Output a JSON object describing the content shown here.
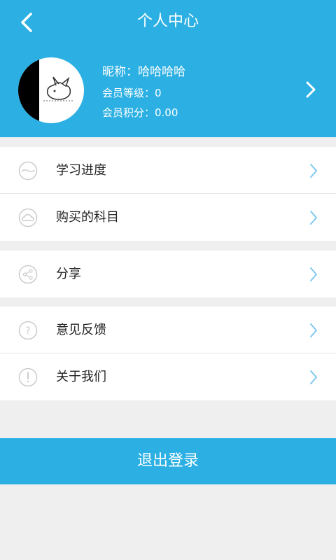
{
  "header": {
    "title": "个人中心",
    "back_icon": "chevron-left-icon"
  },
  "profile": {
    "nickname": "昵称：哈哈哈哈",
    "level": "会员等级：0",
    "points": "会员积分：0.00"
  },
  "menu": {
    "group1": [
      {
        "label": "学习进度",
        "icon": "progress-icon"
      },
      {
        "label": "购买的科目",
        "icon": "cloud-icon"
      }
    ],
    "group2": [
      {
        "label": "分享",
        "icon": "share-icon"
      }
    ],
    "group3": [
      {
        "label": "意见反馈",
        "icon": "question-icon"
      },
      {
        "label": "关于我们",
        "icon": "info-icon"
      }
    ]
  },
  "logout_label": "退出登录",
  "colors": {
    "primary": "#2cb0e3",
    "arrow": "#7fc8ee",
    "icon_gray": "#cccccc",
    "background": "#efefef"
  }
}
